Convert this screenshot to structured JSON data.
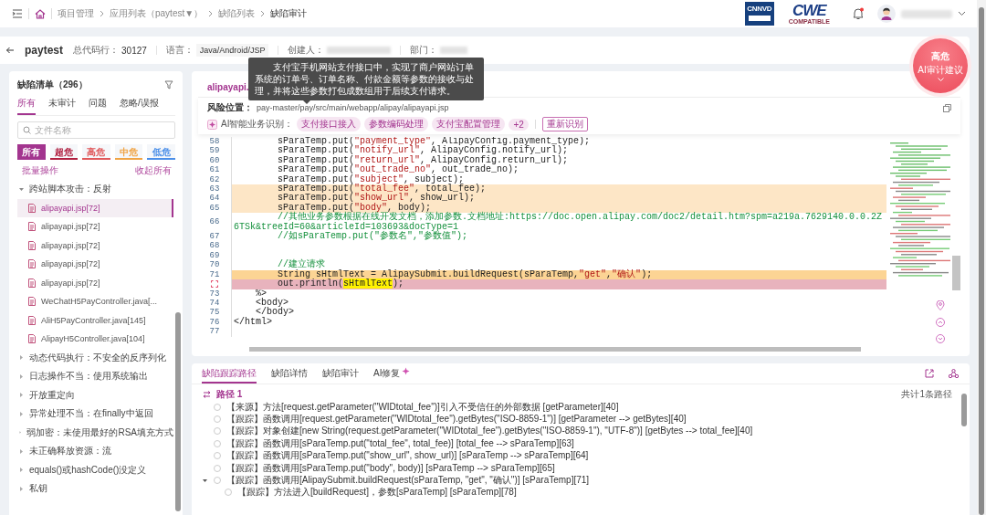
{
  "topbar": {
    "breadcrumb": [
      {
        "label": "项目管理",
        "current": false
      },
      {
        "label": "应用列表（paytest▼）",
        "current": false
      },
      {
        "label": "缺陷列表",
        "current": false
      },
      {
        "label": "缺陷审计",
        "current": true
      }
    ],
    "logos": [
      {
        "kind": "cnnvd",
        "text": "CNNVD"
      },
      {
        "kind": "cwe",
        "text": "CWE",
        "subtitle": "COMPATIBLE"
      }
    ],
    "notifications": {
      "unread": true
    }
  },
  "project": {
    "name": "paytest",
    "lines_label": "总代码行：",
    "lines": "30127",
    "language_label": "语言：",
    "language": "Java/Android/JSP",
    "creator_label": "创建人：",
    "department_label": "部门："
  },
  "tooltip": {
    "text": "　　支付宝手机网站支付接口中，实现了商户网站订单系统的订单号、订单名称、付款金额等参数的接收与处理，并将这些参数打包成数组用于后续支付请求。"
  },
  "ai_badge": {
    "level": "高危",
    "label": "AI审计建议"
  },
  "defect_list": {
    "title": "缺陷清单（296）",
    "tabs": [
      {
        "label": "所有",
        "selected": true
      },
      {
        "label": "未审计",
        "selected": false
      },
      {
        "label": "问题",
        "selected": false
      },
      {
        "label": "忽略/误报",
        "selected": false
      }
    ],
    "search": {
      "placeholder": "文件名称"
    },
    "severities": [
      {
        "label": "所有",
        "selected": true,
        "color": "#a3358f"
      },
      {
        "label": "超危",
        "selected": false,
        "color": "#b02040"
      },
      {
        "label": "高危",
        "selected": false,
        "color": "#e0585a"
      },
      {
        "label": "中危",
        "selected": false,
        "color": "#f0a445"
      },
      {
        "label": "低危",
        "selected": false,
        "color": "#4a8ee8"
      }
    ],
    "batch": "批量操作",
    "collapse_all": "收起所有",
    "groups": [
      {
        "label": "跨站脚本攻击：反射",
        "expanded": true,
        "children": [
          {
            "label": "alipayapi.jsp[72]",
            "selected": true
          },
          {
            "label": "alipayapi.jsp[72]",
            "selected": false
          },
          {
            "label": "alipayapi.jsp[72]",
            "selected": false
          },
          {
            "label": "alipayapi.jsp[72]",
            "selected": false
          },
          {
            "label": "alipayapi.jsp[72]",
            "selected": false
          },
          {
            "label": "WeChatH5PayController.java[...",
            "selected": false
          },
          {
            "label": "AliH5PayController.java[145]",
            "selected": false
          },
          {
            "label": "AlipayH5Controller.java[104]",
            "selected": false
          }
        ]
      },
      {
        "label": "动态代码执行：不安全的反序列化",
        "expanded": false
      },
      {
        "label": "日志操作不当：使用系统输出",
        "expanded": false
      },
      {
        "label": "开放重定向",
        "expanded": false
      },
      {
        "label": "异常处理不当：在finally中返回",
        "expanded": false
      },
      {
        "label": "弱加密：未使用最好的RSA填充方式",
        "expanded": false
      },
      {
        "label": "未正确释放资源：流",
        "expanded": false
      },
      {
        "label": "equals()或hashCode()没定义",
        "expanded": false
      },
      {
        "label": "私钥",
        "expanded": false
      }
    ]
  },
  "code_view": {
    "file_tab": "alipayapi.",
    "risk_label": "风险位置：",
    "risk_path": "pay-master/pay/src/main/webapp/alipay/alipayapi.jsp",
    "ai_label": "AI智能业务识别：",
    "tags": [
      "支付接口接入",
      "参数编码处理",
      "支付宝配置管理",
      "+2"
    ],
    "reidentify": "重新识别",
    "lines": [
      {
        "number": "58",
        "kind": "code",
        "traced": false,
        "focused": false,
        "flagged": false,
        "text": "        sParaTemp.put(\"payment_type\", AlipayConfig.payment_type);"
      },
      {
        "number": "59",
        "kind": "code",
        "traced": false,
        "focused": false,
        "flagged": false,
        "text": "        sParaTemp.put(\"notify_url\", AlipayConfig.notify_url);"
      },
      {
        "number": "60",
        "kind": "code",
        "traced": false,
        "focused": false,
        "flagged": false,
        "text": "        sParaTemp.put(\"return_url\", AlipayConfig.return_url);"
      },
      {
        "number": "61",
        "kind": "code",
        "traced": false,
        "focused": false,
        "flagged": false,
        "text": "        sParaTemp.put(\"out_trade_no\", out_trade_no);"
      },
      {
        "number": "62",
        "kind": "code",
        "traced": false,
        "focused": false,
        "flagged": false,
        "text": "        sParaTemp.put(\"subject\", subject);"
      },
      {
        "number": "63",
        "kind": "code",
        "traced": true,
        "focused": false,
        "flagged": false,
        "text": "        sParaTemp.put(\"total_fee\", total_fee);"
      },
      {
        "number": "64",
        "kind": "code",
        "traced": true,
        "focused": false,
        "flagged": false,
        "text": "        sParaTemp.put(\"show_url\", show_url);"
      },
      {
        "number": "65",
        "kind": "code",
        "traced": true,
        "focused": false,
        "flagged": false,
        "text": "        sParaTemp.put(\"body\", body);"
      },
      {
        "number": "66",
        "kind": "comment",
        "traced": false,
        "focused": false,
        "flagged": false,
        "text": "        //其他业务参数根据在线开发文档，添加参数.文档地址:https://doc.open.alipay.com/doc2/detail.htm?spm=a219a.7629140.0.0.2Z6TSk&treeId=60&articleId=103693&docType=1"
      },
      {
        "number": "67",
        "kind": "comment",
        "traced": false,
        "focused": false,
        "flagged": false,
        "text": "        //如sParaTemp.put(\"参数名\",\"参数值\");"
      },
      {
        "number": "68",
        "kind": "blank",
        "traced": false,
        "focused": false,
        "flagged": false
      },
      {
        "number": "69",
        "kind": "blank",
        "traced": false,
        "focused": false,
        "flagged": false
      },
      {
        "number": "70",
        "kind": "comment",
        "traced": false,
        "focused": false,
        "flagged": false,
        "text": "        //建立请求"
      },
      {
        "number": "71",
        "kind": "code",
        "traced": false,
        "focused": true,
        "flagged": false,
        "text": "        String sHtmlText = AlipaySubmit.buildRequest(sParaTemp,\"get\",\"确认\");"
      },
      {
        "kind": "code",
        "traced": false,
        "focused": false,
        "flagged": true,
        "text": "        out.println(",
        "marked": "sHtmlText",
        "rest": ");"
      },
      {
        "number": "73",
        "kind": "code",
        "traced": false,
        "focused": false,
        "flagged": false,
        "text": "    %>"
      },
      {
        "number": "74",
        "kind": "code",
        "traced": false,
        "focused": false,
        "flagged": false,
        "text": "    <body>"
      },
      {
        "number": "75",
        "kind": "code",
        "traced": false,
        "focused": false,
        "flagged": false,
        "text": "    </body>"
      },
      {
        "number": "76",
        "kind": "code",
        "traced": false,
        "focused": false,
        "flagged": false,
        "text": "</html>"
      },
      {
        "number": "77",
        "kind": "blank",
        "traced": false,
        "focused": false,
        "flagged": false
      }
    ]
  },
  "trace": {
    "tabs": [
      {
        "label": "缺陷跟踪路径",
        "selected": true,
        "ai": false
      },
      {
        "label": "缺陷详情",
        "selected": false,
        "ai": false
      },
      {
        "label": "缺陷审计",
        "selected": false,
        "ai": false
      },
      {
        "label": "AI修复",
        "selected": false,
        "ai": true
      }
    ],
    "path_title": "路径 1",
    "path_count": "共计1条路径",
    "steps": [
      {
        "checked": false,
        "text": "【来源】方法[request.getParameter(\"WIDtotal_fee\")]引入不受信任的外部数据 [getParameter][40]"
      },
      {
        "checked": false,
        "text": "【跟踪】函数调用[request.getParameter(\"WIDtotal_fee\").getBytes(\"ISO-8859-1\")] [getParameter --> getBytes][40]"
      },
      {
        "checked": false,
        "text": "【跟踪】对象创建[new String(request.getParameter(\"WIDtotal_fee\").getBytes(\"ISO-8859-1\"), \"UTF-8\")] [getBytes --> total_fee][40]"
      },
      {
        "checked": false,
        "text": "【跟踪】函数调用[sParaTemp.put(\"total_fee\", total_fee)] [total_fee --> sParaTemp][63]"
      },
      {
        "checked": false,
        "text": "【跟踪】函数调用[sParaTemp.put(\"show_url\", show_url)] [sParaTemp --> sParaTemp][64]"
      },
      {
        "checked": false,
        "text": "【跟踪】函数调用[sParaTemp.put(\"body\", body)] [sParaTemp --> sParaTemp][65]"
      },
      {
        "checked": false,
        "text": "【跟踪】函数调用[AlipaySubmit.buildRequest(sParaTemp, \"get\", \"确认\")] [sParaTemp][71]",
        "expanded": true,
        "children": [
          {
            "checked": false,
            "text": "【跟踪】方法进入[buildRequest]，参数[sParaTemp] [sParaTemp][78]"
          }
        ]
      }
    ]
  }
}
